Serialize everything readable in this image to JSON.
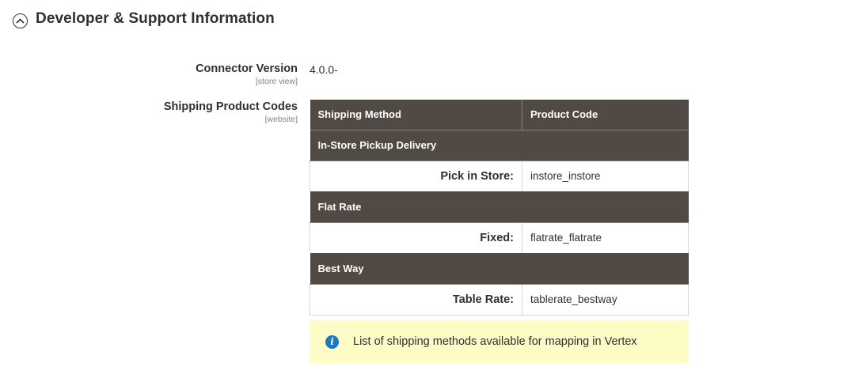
{
  "section": {
    "title": "Developer & Support Information",
    "icon": "chevron-up-circle-icon"
  },
  "connector_version": {
    "label": "Connector Version",
    "scope": "[store view]",
    "value": "4.0.0-"
  },
  "shipping_product_codes": {
    "label": "Shipping Product Codes",
    "scope": "[website]",
    "headers": {
      "method": "Shipping Method",
      "code": "Product Code"
    },
    "groups": [
      {
        "name": "In-Store Pickup Delivery",
        "method": "Pick in Store:",
        "code": "instore_instore"
      },
      {
        "name": "Flat Rate",
        "method": "Fixed:",
        "code": "flatrate_flatrate"
      },
      {
        "name": "Best Way",
        "method": "Table Rate:",
        "code": "tablerate_bestway"
      }
    ]
  },
  "notice": {
    "icon": "info-icon",
    "text": "List of shipping methods available for mapping in Vertex"
  },
  "colors": {
    "table_header": "#514943",
    "notice_bg": "#fdfbc6",
    "info_icon": "#1979c3"
  }
}
